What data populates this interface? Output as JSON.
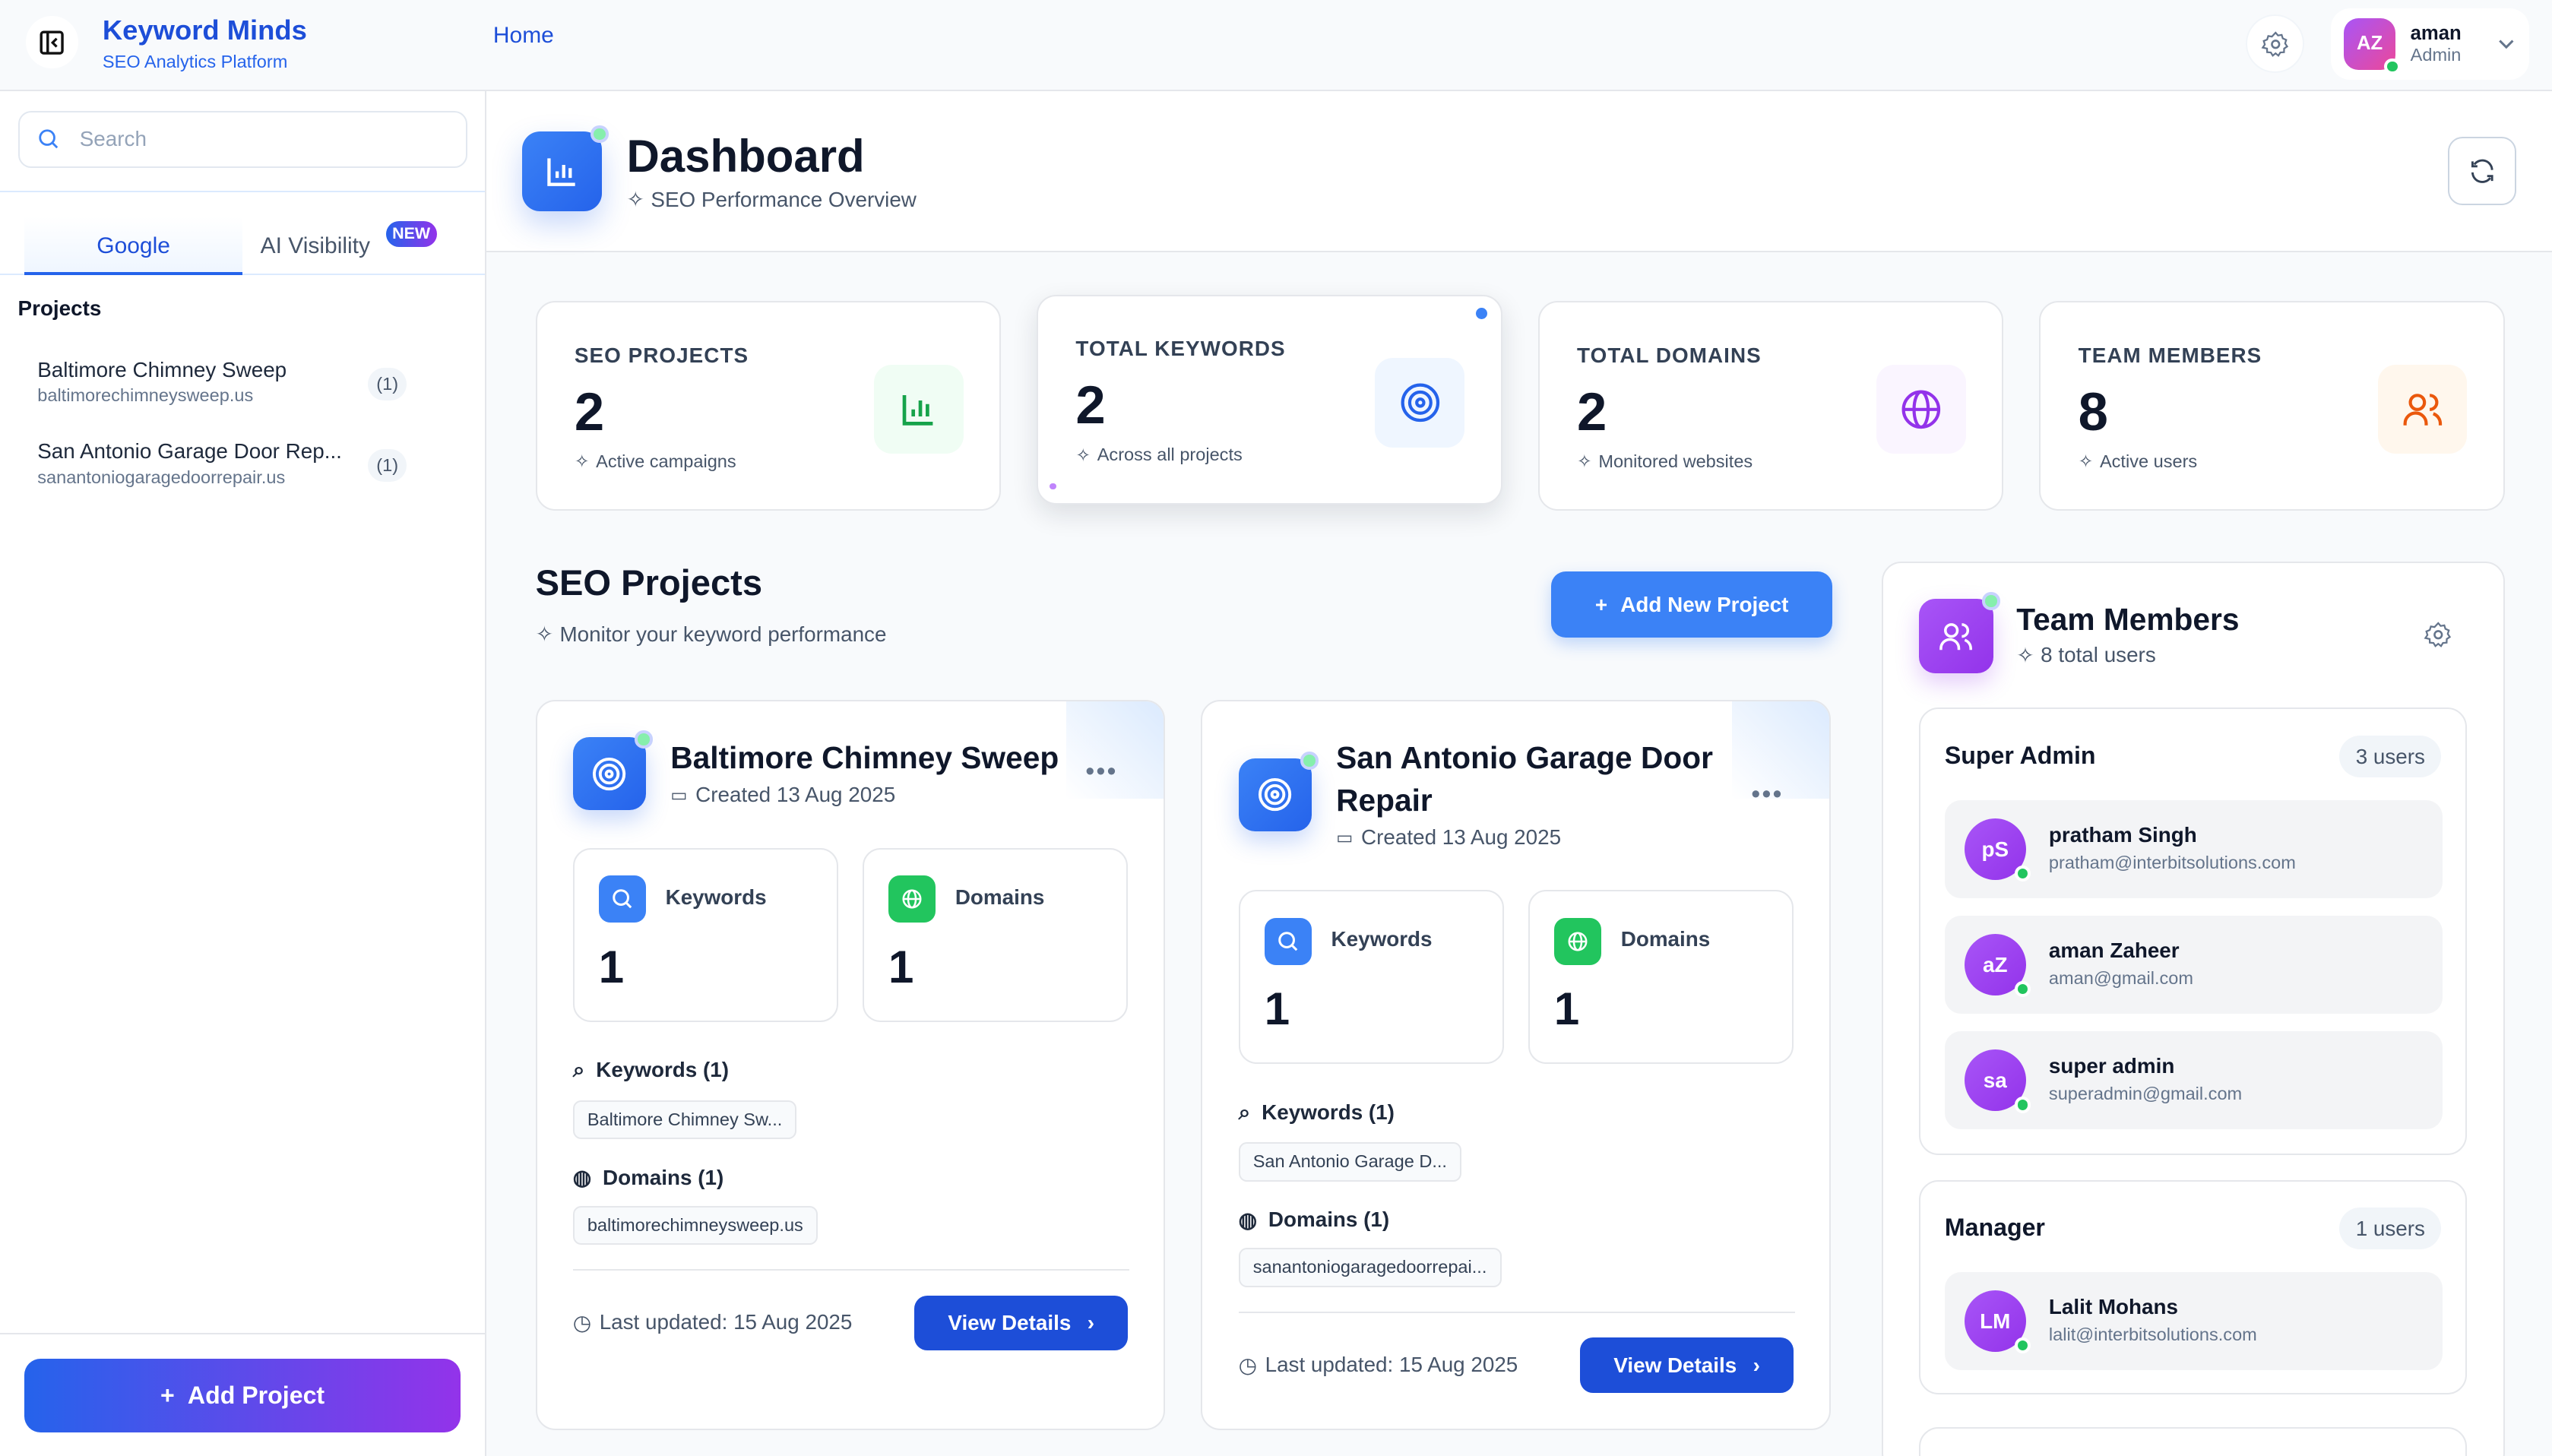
{
  "header": {
    "brand_title": "Keyword Minds",
    "brand_subtitle": "SEO Analytics Platform",
    "nav_home": "Home",
    "user": {
      "initials": "AZ",
      "name": "aman",
      "role": "Admin"
    }
  },
  "sidebar": {
    "search_placeholder": "Search",
    "tabs": [
      {
        "label": "Google",
        "active": true
      },
      {
        "label": "AI Visibility",
        "badge": "NEW"
      }
    ],
    "projects_label": "Projects",
    "projects": [
      {
        "name": "Baltimore Chimney Sweep",
        "domain": "baltimorechimneysweep.us",
        "count": "(1)"
      },
      {
        "name": "San Antonio Garage Door Rep...",
        "domain": "sanantoniogaragedoorrepair.us",
        "count": "(1)"
      }
    ],
    "add_project_label": "Add Project"
  },
  "dashboard": {
    "title": "Dashboard",
    "subtitle": "SEO Performance Overview"
  },
  "stats": [
    {
      "label": "SEO PROJECTS",
      "value": "2",
      "sub": "Active campaigns",
      "color": "#16a34a"
    },
    {
      "label": "TOTAL KEYWORDS",
      "value": "2",
      "sub": "Across all projects",
      "color": "#2563eb"
    },
    {
      "label": "TOTAL DOMAINS",
      "value": "2",
      "sub": "Monitored websites",
      "color": "#9333ea"
    },
    {
      "label": "TEAM MEMBERS",
      "value": "8",
      "sub": "Active users",
      "color": "#ea580c"
    }
  ],
  "seo_projects": {
    "title": "SEO Projects",
    "subtitle": "Monitor your keyword performance",
    "add_label": "Add New Project",
    "cards": [
      {
        "title": "Baltimore Chimney Sweep",
        "created": "Created 13 Aug 2025",
        "keywords_label": "Keywords",
        "keywords_value": "1",
        "domains_label": "Domains",
        "domains_value": "1",
        "keywords_list_label": "Keywords (1)",
        "keyword_chip": "Baltimore Chimney Sw...",
        "domains_list_label": "Domains (1)",
        "domain_chip": "baltimorechimneysweep.us",
        "updated": "Last updated: 15 Aug 2025",
        "view_label": "View Details"
      },
      {
        "title": "San Antonio Garage Door Repair",
        "created": "Created 13 Aug 2025",
        "keywords_label": "Keywords",
        "keywords_value": "1",
        "domains_label": "Domains",
        "domains_value": "1",
        "keywords_list_label": "Keywords (1)",
        "keyword_chip": "San Antonio Garage D...",
        "domains_list_label": "Domains (1)",
        "domain_chip": "sanantoniogaragedoorrepai...",
        "updated": "Last updated: 15 Aug 2025",
        "view_label": "View Details"
      }
    ]
  },
  "team": {
    "title": "Team Members",
    "subtitle": "8 total users",
    "groups": [
      {
        "name": "Super Admin",
        "count": "3 users",
        "members": [
          {
            "initials": "pS",
            "name": "pratham Singh",
            "email": "pratham@interbitsolutions.com"
          },
          {
            "initials": "aZ",
            "name": "aman Zaheer",
            "email": "aman@gmail.com"
          },
          {
            "initials": "sa",
            "name": "super admin",
            "email": "superadmin@gmail.com"
          }
        ]
      },
      {
        "name": "Manager",
        "count": "1 users",
        "members": [
          {
            "initials": "LM",
            "name": "Lalit Mohans",
            "email": "lalit@interbitsolutions.com"
          }
        ]
      }
    ]
  }
}
